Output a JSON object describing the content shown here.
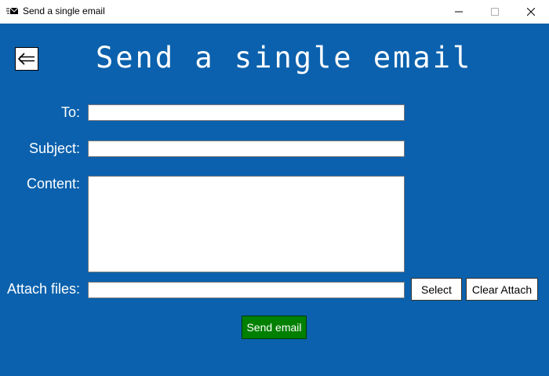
{
  "window": {
    "title": "Send a single email",
    "background_color": "#0b61ad"
  },
  "header": {
    "back_icon": "back-arrow-icon",
    "title": "Send a single email"
  },
  "form": {
    "to_label": "To:",
    "to_value": "",
    "subject_label": "Subject:",
    "subject_value": "",
    "content_label": "Content:",
    "content_value": "",
    "attach_label": "Attach files:",
    "attach_value": ""
  },
  "buttons": {
    "select_label": "Select",
    "clear_attach_label": "Clear Attach",
    "send_label": "Send email",
    "send_color": "#008000"
  }
}
